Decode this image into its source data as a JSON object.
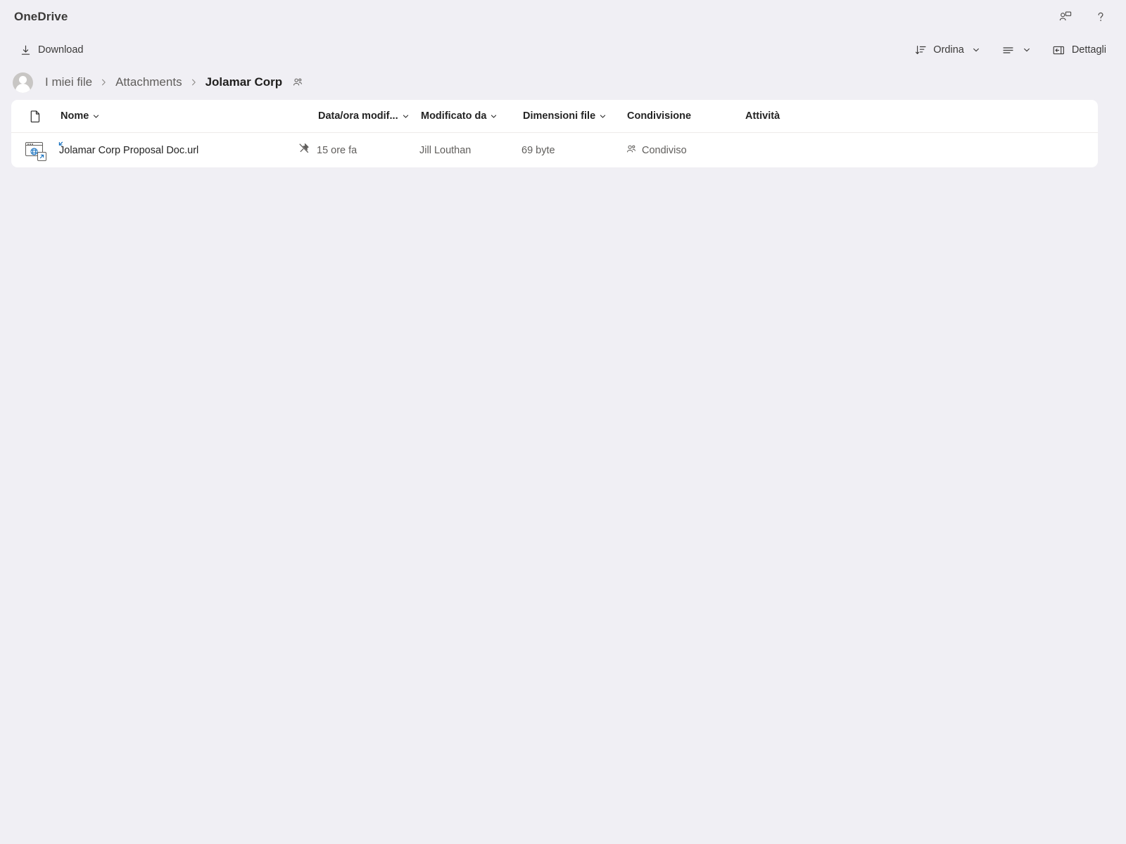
{
  "app": {
    "brand": "OneDrive",
    "header_icons": [
      {
        "name": "feedback-icon",
        "title": "Feedback"
      },
      {
        "name": "help-icon",
        "title": "?"
      }
    ]
  },
  "command_bar": {
    "download_label": "Download",
    "sort_label": "Ordina",
    "details_label": "Dettagli",
    "view_label": ""
  },
  "breadcrumb": {
    "items": [
      {
        "label": "I miei file",
        "current": false
      },
      {
        "label": "Attachments",
        "current": false
      },
      {
        "label": "Jolamar Corp",
        "current": true
      }
    ],
    "separator": "›"
  },
  "file_list": {
    "columns": [
      {
        "key": "name",
        "label": "Nome",
        "sortable": true
      },
      {
        "key": "date",
        "label": "Data/ora modif...",
        "sortable": true
      },
      {
        "key": "by",
        "label": "Modificato da",
        "sortable": true
      },
      {
        "key": "size",
        "label": "Dimensioni file",
        "sortable": true
      },
      {
        "key": "share",
        "label": "Condivisione",
        "sortable": false
      },
      {
        "key": "act",
        "label": "Attività",
        "sortable": false
      }
    ],
    "rows": [
      {
        "icon": "url-shortcut-icon",
        "name": "Jolamar Corp Proposal Doc.url",
        "date": "15 ore fa",
        "modified_by": "Jill Louthan",
        "size": "69 byte",
        "sharing": "Condiviso",
        "activity": ""
      }
    ]
  },
  "colors": {
    "background": "#f0eff4",
    "card": "#ffffff",
    "text_primary": "#242424",
    "text_secondary": "#605e5c",
    "accent_blue": "#0f6cbd",
    "divider": "#edebe9"
  }
}
